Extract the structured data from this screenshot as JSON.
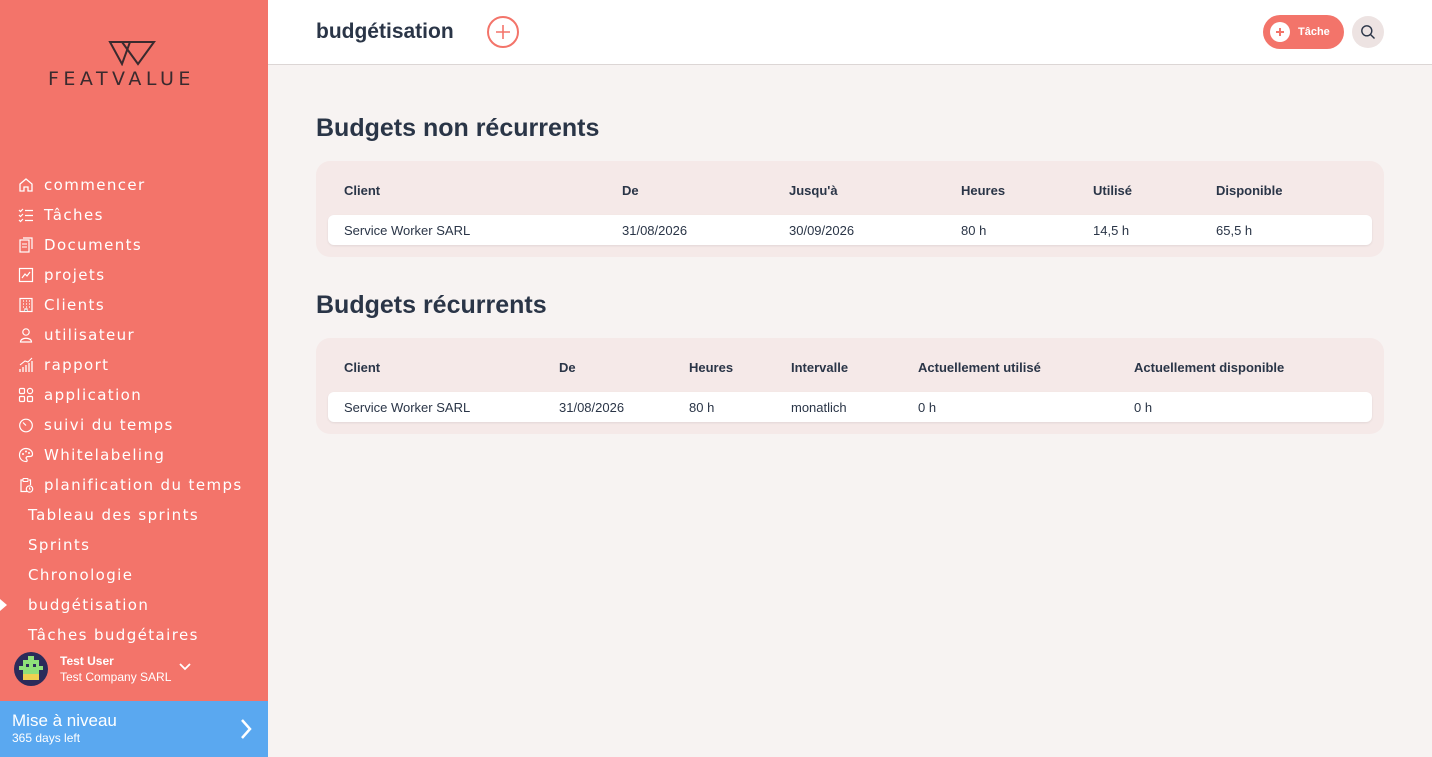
{
  "brand": {
    "logo_text": "FEATVALUE"
  },
  "sidebar": {
    "items": [
      {
        "label": "commencer",
        "icon": "home-icon"
      },
      {
        "label": "Tâches",
        "icon": "task-list-icon"
      },
      {
        "label": "Documents",
        "icon": "documents-icon"
      },
      {
        "label": "projets",
        "icon": "projects-icon"
      },
      {
        "label": "Clients",
        "icon": "building-icon"
      },
      {
        "label": "utilisateur",
        "icon": "user-icon"
      },
      {
        "label": "rapport",
        "icon": "report-icon"
      },
      {
        "label": "application",
        "icon": "apps-icon"
      },
      {
        "label": "suivi du temps",
        "icon": "timer-icon"
      },
      {
        "label": "Whitelabeling",
        "icon": "palette-icon"
      },
      {
        "label": "planification du temps",
        "icon": "schedule-icon"
      }
    ],
    "sub_items": [
      {
        "label": "Tableau des sprints"
      },
      {
        "label": "Sprints"
      },
      {
        "label": "Chronologie"
      },
      {
        "label": "budgétisation"
      },
      {
        "label": "Tâches budgétaires"
      }
    ],
    "active_sub_item": "budgétisation",
    "user": {
      "name": "Test User",
      "company": "Test Company SARL"
    },
    "upgrade": {
      "title": "Mise à niveau",
      "subtitle": "365 days left"
    }
  },
  "header": {
    "title": "budgétisation",
    "task_button_label": "Tâche"
  },
  "non_recurring": {
    "title": "Budgets non récurrents",
    "columns": [
      "Client",
      "De",
      "Jusqu'à",
      "Heures",
      "Utilisé",
      "Disponible"
    ],
    "rows": [
      [
        "Service Worker SARL",
        "31/08/2026",
        "30/09/2026",
        "80 h",
        "14,5 h",
        "65,5 h"
      ]
    ]
  },
  "recurring": {
    "title": "Budgets récurrents",
    "columns": [
      "Client",
      "De",
      "Heures",
      "Intervalle",
      "Actuellement utilisé",
      "Actuellement disponible"
    ],
    "rows": [
      [
        "Service Worker SARL",
        "31/08/2026",
        "80 h",
        "monatlich",
        "0 h",
        "0 h"
      ]
    ]
  },
  "colors": {
    "sidebar": "#f3746a",
    "accent": "#f3746a",
    "upgrade": "#5aa8f0",
    "text": "#2a3547",
    "card": "#f5e9e8"
  }
}
